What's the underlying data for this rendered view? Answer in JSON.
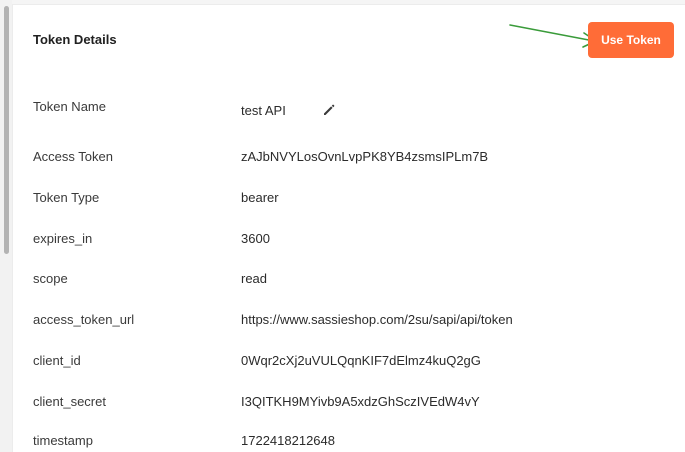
{
  "panel": {
    "title": "Token Details",
    "use_token_label": "Use Token",
    "accent_color": "#FF6C37",
    "annotation_arrow_color": "#3A9B3A"
  },
  "fields": [
    {
      "key": "Token Name",
      "value": "test API",
      "editable": true
    },
    {
      "key": "Access Token",
      "value": "zAJbNVYLosOvnLvpPK8YB4zsmsIPLm7B"
    },
    {
      "key": "Token Type",
      "value": "bearer"
    },
    {
      "key": "expires_in",
      "value": "3600"
    },
    {
      "key": "scope",
      "value": "read"
    },
    {
      "key": "access_token_url",
      "value": "https://www.sassieshop.com/2su/sapi/api/token"
    },
    {
      "key": "client_id",
      "value": "0Wqr2cXj2uVULQqnKIF7dElmz4kuQ2gG"
    },
    {
      "key": "client_secret",
      "value": "I3QITKH9MYivb9A5xdzGhSczIVEdW4vY"
    },
    {
      "key": "timestamp",
      "value": "1722418212648"
    }
  ],
  "icons": {
    "edit": "pencil-icon"
  }
}
